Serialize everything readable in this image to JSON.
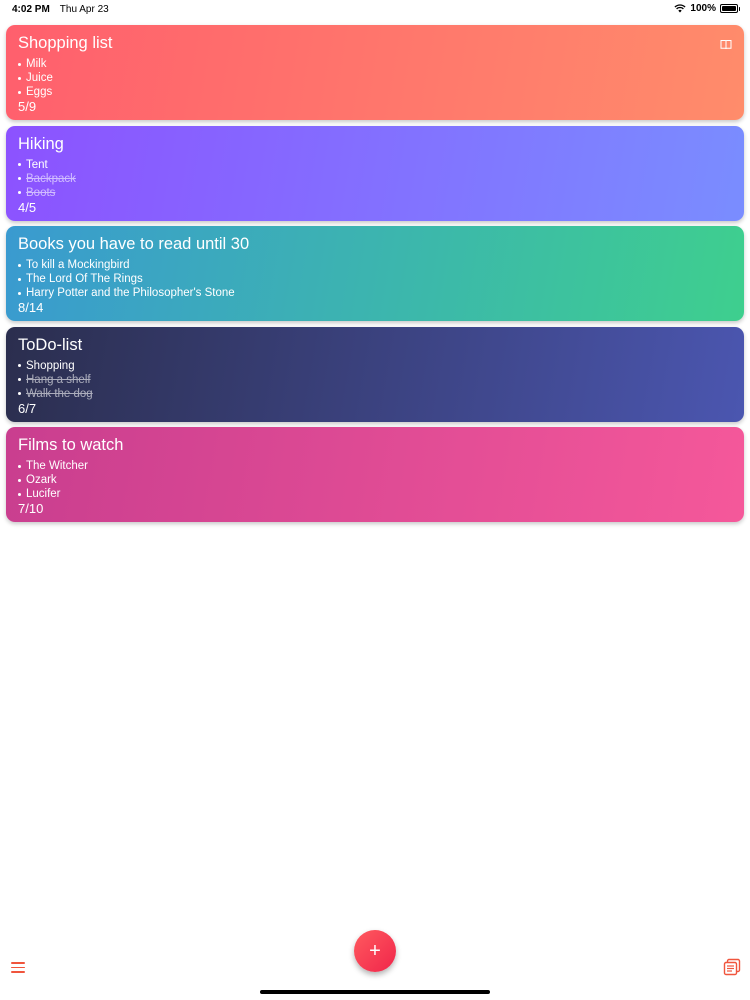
{
  "status": {
    "time": "4:02 PM",
    "date": "Thu Apr 23",
    "battery": "100%"
  },
  "lists": [
    {
      "title": "Shopping list",
      "items": [
        {
          "text": "Milk",
          "done": false
        },
        {
          "text": "Juice",
          "done": false
        },
        {
          "text": "Eggs",
          "done": false
        }
      ],
      "count": "5/9",
      "gradient": [
        "#ff5f6d",
        "#ff8c6b"
      ],
      "icon": "book-icon"
    },
    {
      "title": "Hiking",
      "items": [
        {
          "text": "Tent",
          "done": false
        },
        {
          "text": "Backpack",
          "done": true
        },
        {
          "text": "Boots",
          "done": true
        }
      ],
      "count": "4/5",
      "gradient": [
        "#8c52ff",
        "#7a8dff"
      ]
    },
    {
      "title": "Books you have to read until 30",
      "items": [
        {
          "text": "To kill a Mockingbird",
          "done": false
        },
        {
          "text": "The Lord Of The Rings",
          "done": false
        },
        {
          "text": "Harry Potter and the Philosopher's Stone",
          "done": false
        }
      ],
      "count": "8/14",
      "gradient": [
        "#3a9ad0",
        "#3ecf8e"
      ]
    },
    {
      "title": "ToDo-list",
      "items": [
        {
          "text": "Shopping",
          "done": false
        },
        {
          "text": "Hang a shelf",
          "done": true
        },
        {
          "text": "Walk the dog",
          "done": true
        }
      ],
      "count": "6/7",
      "gradient": [
        "#2b2e4e",
        "#4b56b0"
      ]
    },
    {
      "title": "Films to watch",
      "items": [
        {
          "text": "The Witcher",
          "done": false
        },
        {
          "text": "Ozark",
          "done": false
        },
        {
          "text": "Lucifer",
          "done": false
        }
      ],
      "count": "7/10",
      "gradient": [
        "#c93e8f",
        "#f5589a"
      ]
    }
  ],
  "toolbar": {
    "add_label": "+",
    "menu_icon": "menu-icon",
    "grid_icon": "grid-icon",
    "accent": "#f0553d"
  }
}
